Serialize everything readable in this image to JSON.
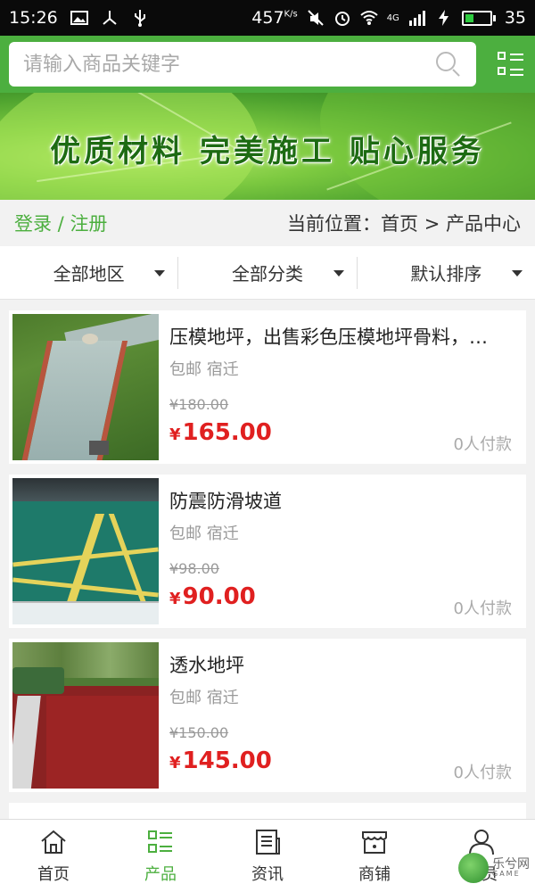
{
  "status_bar": {
    "time": "15:26",
    "speed": "457",
    "speed_unit": "K/s",
    "battery": "35",
    "network": "4G",
    "icons": [
      "image-icon",
      "usb-debug-icon",
      "usb-icon",
      "mute-icon",
      "alarm-icon",
      "wifi-icon",
      "signal-icon",
      "charging-icon",
      "battery-icon"
    ]
  },
  "search": {
    "placeholder": "请输入商品关键字",
    "value": ""
  },
  "banner": {
    "slogan": "优质材料  完美施工  贴心服务"
  },
  "breadcrumb": {
    "login": "登录",
    "separator": " / ",
    "register": "注册",
    "current_label": "当前位置：",
    "home": "首页",
    "arrow": " > ",
    "page": "产品中心"
  },
  "filters": [
    {
      "label": "全部地区"
    },
    {
      "label": "全部分类"
    },
    {
      "label": "默认排序"
    }
  ],
  "products": [
    {
      "title": "压模地坪，出售彩色压模地坪骨料，…",
      "meta": "包邮 宿迁",
      "old_price": "¥180.00",
      "price_symbol": "¥",
      "price": "165.00",
      "sold": "0人付款"
    },
    {
      "title": "防震防滑坡道",
      "meta": "包邮 宿迁",
      "old_price": "¥98.00",
      "price_symbol": "¥",
      "price": "90.00",
      "sold": "0人付款"
    },
    {
      "title": "透水地坪",
      "meta": "包邮 宿迁",
      "old_price": "¥150.00",
      "price_symbol": "¥",
      "price": "145.00",
      "sold": "0人付款"
    }
  ],
  "tabbar": [
    {
      "label": "首页",
      "icon": "home-icon"
    },
    {
      "label": "产品",
      "icon": "product-list-icon",
      "active": true
    },
    {
      "label": "资讯",
      "icon": "news-icon"
    },
    {
      "label": "商铺",
      "icon": "shop-icon"
    },
    {
      "label": "会员",
      "icon": "member-icon"
    }
  ],
  "watermark": {
    "text": "乐兮网",
    "sub": "GAME"
  },
  "colors": {
    "brand_green": "#4caf3f",
    "price_red": "#e02020"
  }
}
